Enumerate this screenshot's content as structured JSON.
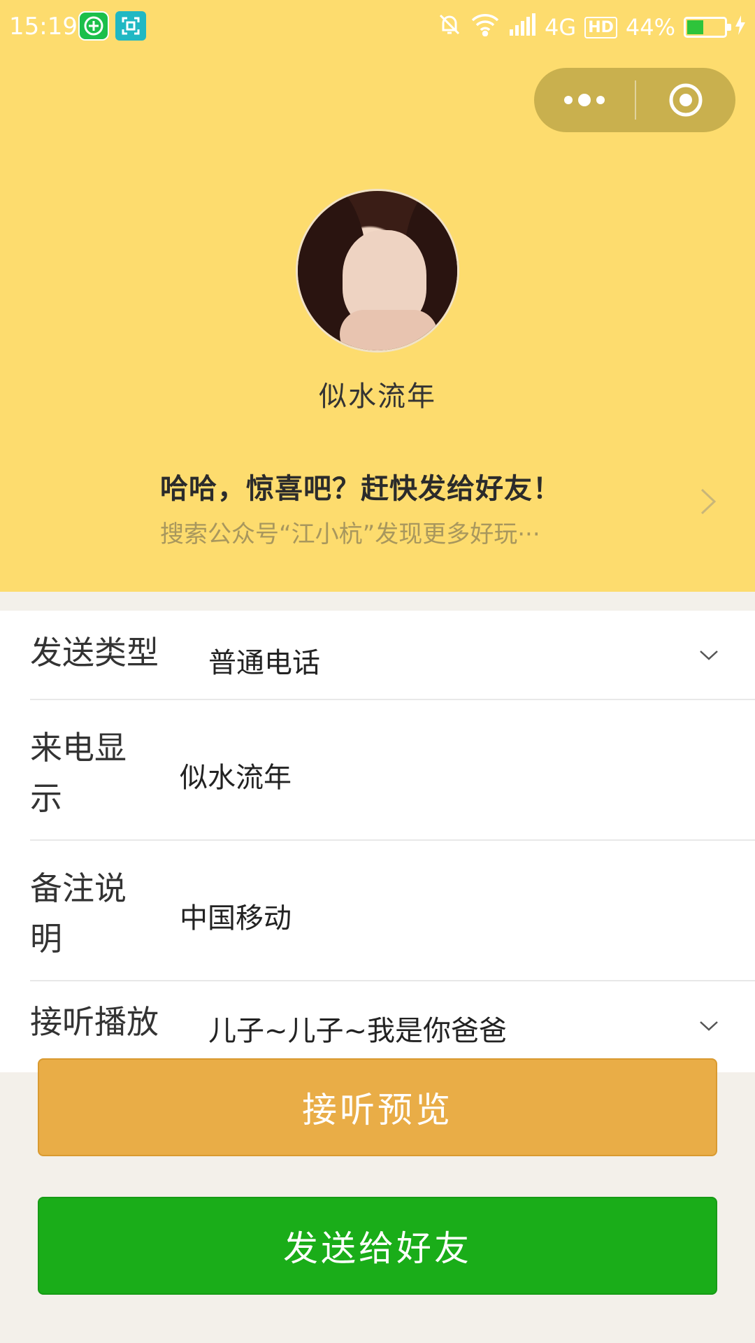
{
  "status_bar": {
    "time": "15:19",
    "network": "4G",
    "hd": "HD",
    "battery_percent": "44%",
    "battery_level": 0.44,
    "icons": [
      "app-shortcut-icon",
      "scan-icon",
      "silent-bell-icon",
      "wifi-icon",
      "signal-icon",
      "battery-icon",
      "charging-icon"
    ]
  },
  "capsule": {
    "more_icon": "more-dots-icon",
    "close_icon": "target-close-icon"
  },
  "profile": {
    "nickname": "似水流年"
  },
  "promo": {
    "title": "哈哈，惊喜吧？赶快发给好友！",
    "subtitle": "搜索公众号“江小杭”发现更多好玩···"
  },
  "form": {
    "send_type": {
      "label": "发送类型",
      "value": "普通电话"
    },
    "caller_display": {
      "label": "来电显示",
      "value": "似水流年"
    },
    "remark": {
      "label": "备注说明",
      "value": "中国移动"
    },
    "playback": {
      "label": "接听播放",
      "value": "儿子~儿子~我是你爸爸"
    }
  },
  "buttons": {
    "preview": "接听预览",
    "send": "发送给好友"
  },
  "colors": {
    "header_bg": "#fddc6e",
    "preview_btn": "#e9ad47",
    "send_btn": "#1aad19",
    "page_bg": "#f3f0ea"
  }
}
